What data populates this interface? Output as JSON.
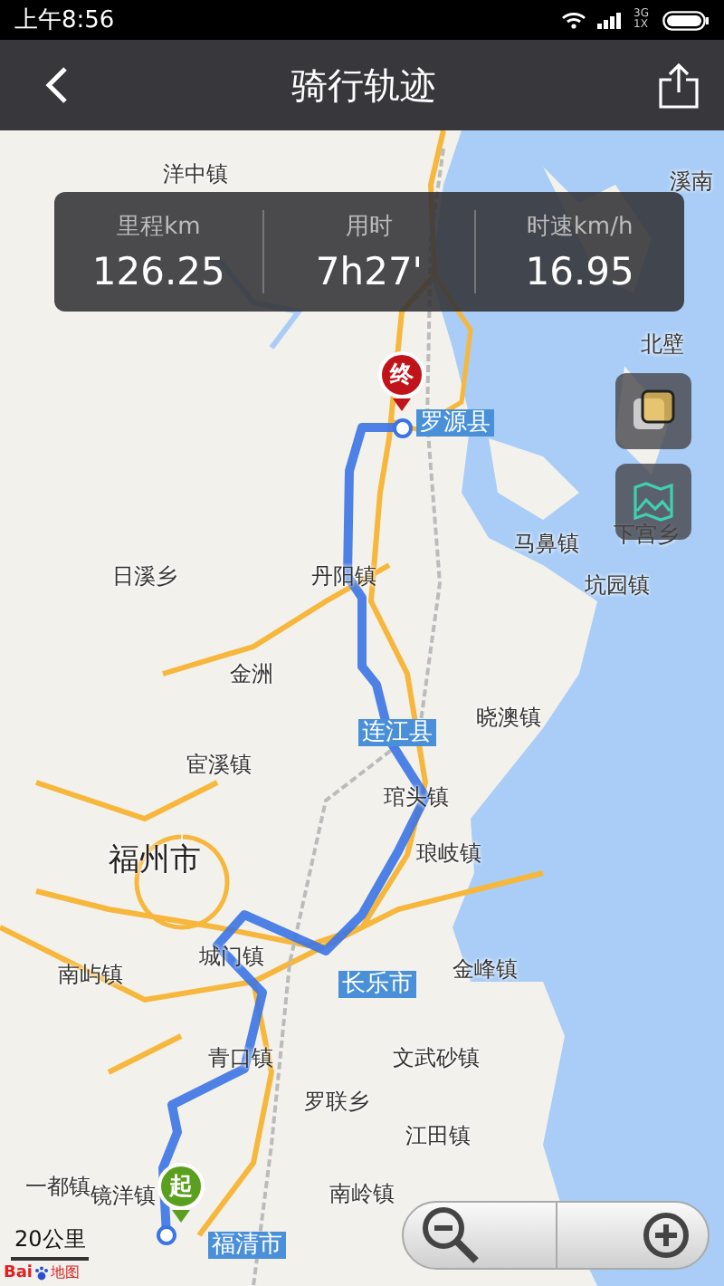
{
  "status_bar": {
    "time": "上午8:56",
    "network": "3G 1X"
  },
  "header": {
    "title": "骑行轨迹"
  },
  "stats": [
    {
      "label": "里程km",
      "value": "126.25"
    },
    {
      "label": "用时",
      "value": "7h27'"
    },
    {
      "label": "时速km/h",
      "value": "16.95"
    }
  ],
  "map": {
    "labels": [
      {
        "text": "洋中镇",
        "kind": "town"
      },
      {
        "text": "溪南",
        "kind": "town"
      },
      {
        "text": "北壁",
        "kind": "town"
      },
      {
        "text": "罗源县",
        "kind": "county"
      },
      {
        "text": "马鼻镇",
        "kind": "town"
      },
      {
        "text": "下宫乡",
        "kind": "town"
      },
      {
        "text": "坑园镇",
        "kind": "town"
      },
      {
        "text": "日溪乡",
        "kind": "town"
      },
      {
        "text": "丹阳镇",
        "kind": "town"
      },
      {
        "text": "金洲",
        "kind": "town"
      },
      {
        "text": "晓澳镇",
        "kind": "town"
      },
      {
        "text": "连江县",
        "kind": "county"
      },
      {
        "text": "宦溪镇",
        "kind": "town"
      },
      {
        "text": "琯头镇",
        "kind": "town"
      },
      {
        "text": "琅岐镇",
        "kind": "town"
      },
      {
        "text": "福州市",
        "kind": "city"
      },
      {
        "text": "城门镇",
        "kind": "town"
      },
      {
        "text": "南屿镇",
        "kind": "town"
      },
      {
        "text": "金峰镇",
        "kind": "town"
      },
      {
        "text": "长乐市",
        "kind": "county"
      },
      {
        "text": "青口镇",
        "kind": "town"
      },
      {
        "text": "文武砂镇",
        "kind": "town"
      },
      {
        "text": "罗联乡",
        "kind": "town"
      },
      {
        "text": "江田镇",
        "kind": "town"
      },
      {
        "text": "一都镇",
        "kind": "town"
      },
      {
        "text": "镜洋镇",
        "kind": "town"
      },
      {
        "text": "南岭镇",
        "kind": "town"
      },
      {
        "text": "福清市",
        "kind": "county"
      }
    ],
    "end_marker": "终",
    "start_marker": "起",
    "scale": "20公里",
    "logo": {
      "brand": "Bai",
      "suffix": "地图"
    }
  }
}
